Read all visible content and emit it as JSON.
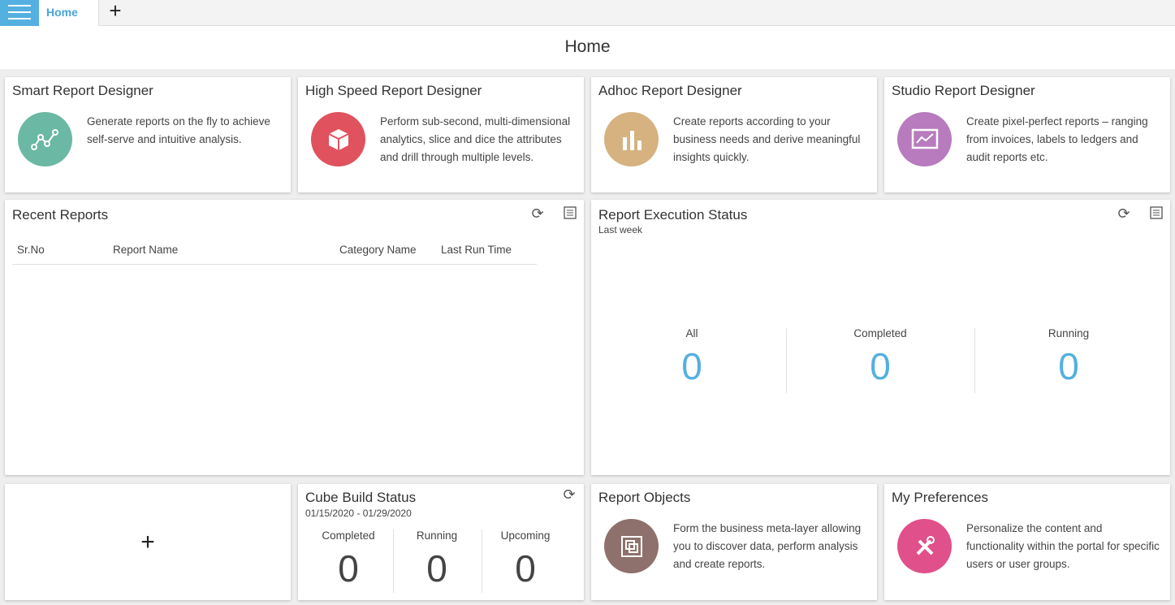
{
  "tabs": {
    "home_label": "Home",
    "add_label": "+"
  },
  "page": {
    "title": "Home"
  },
  "designers": [
    {
      "title": "Smart Report Designer",
      "description": "Generate reports on the fly to achieve self-serve and intuitive analysis.",
      "icon": "line-chart-icon",
      "color": "#6bb8a4"
    },
    {
      "title": "High Speed Report Designer",
      "description": "Perform sub-second, multi-dimensional analytics, slice and dice the attributes and drill through multiple levels.",
      "icon": "cube-icon",
      "color": "#e0525e"
    },
    {
      "title": "Adhoc Report Designer",
      "description": "Create reports according to your business needs and derive meaningful insights quickly.",
      "icon": "bar-chart-icon",
      "color": "#d5b27f"
    },
    {
      "title": "Studio Report Designer",
      "description": "Create pixel-perfect reports – ranging from invoices, labels to ledgers and audit reports etc.",
      "icon": "monitor-chart-icon",
      "color": "#b77bbe"
    }
  ],
  "recent_reports": {
    "title": "Recent Reports",
    "columns": [
      "Sr.No",
      "Report Name",
      "Category Name",
      "Last Run Time"
    ]
  },
  "execution_status": {
    "title": "Report Execution Status",
    "subtitle": "Last week",
    "stats": [
      {
        "label": "All",
        "value": "0"
      },
      {
        "label": "Completed",
        "value": "0"
      },
      {
        "label": "Running",
        "value": "0"
      }
    ],
    "value_color": "#54b0e0"
  },
  "add_widget": {
    "label": "+"
  },
  "cube_build": {
    "title": "Cube Build Status",
    "subtitle": "01/15/2020 - 01/29/2020",
    "stats": [
      {
        "label": "Completed",
        "value": "0"
      },
      {
        "label": "Running",
        "value": "0"
      },
      {
        "label": "Upcoming",
        "value": "0"
      }
    ]
  },
  "report_objects": {
    "title": "Report Objects",
    "description": "Form the business meta-layer allowing you to discover data, perform analysis and create reports.",
    "icon": "objects-icon",
    "color": "#8e716c"
  },
  "preferences": {
    "title": "My Preferences",
    "description": "Personalize the content and functionality within the portal for specific users or user groups.",
    "icon": "tools-icon",
    "color": "#e0508b"
  },
  "accent_color": "#54b0e0"
}
